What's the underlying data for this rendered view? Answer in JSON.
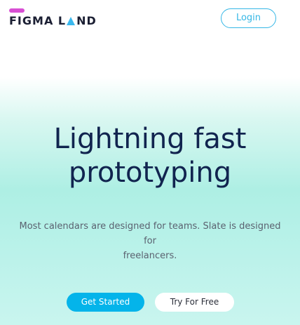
{
  "header": {
    "logo": {
      "part1": "FIGMA L",
      "part2": "ND",
      "mark_color": "#d84fd3",
      "accent_color": "#3ab8ee",
      "text_color": "#1b1f33"
    },
    "login_label": "Login",
    "login_color": "#35b7e6"
  },
  "hero": {
    "title_line1": "Lightning fast",
    "title_line2": "prototyping",
    "title_color": "#11244f",
    "subtitle_line1": "Most calendars are designed for teams. Slate is designed for",
    "subtitle_line2": "freelancers.",
    "subtitle_color": "#5b6270"
  },
  "actions": {
    "primary_label": "Get Started",
    "primary_color": "#04b4ea",
    "secondary_label": "Try For Free"
  }
}
